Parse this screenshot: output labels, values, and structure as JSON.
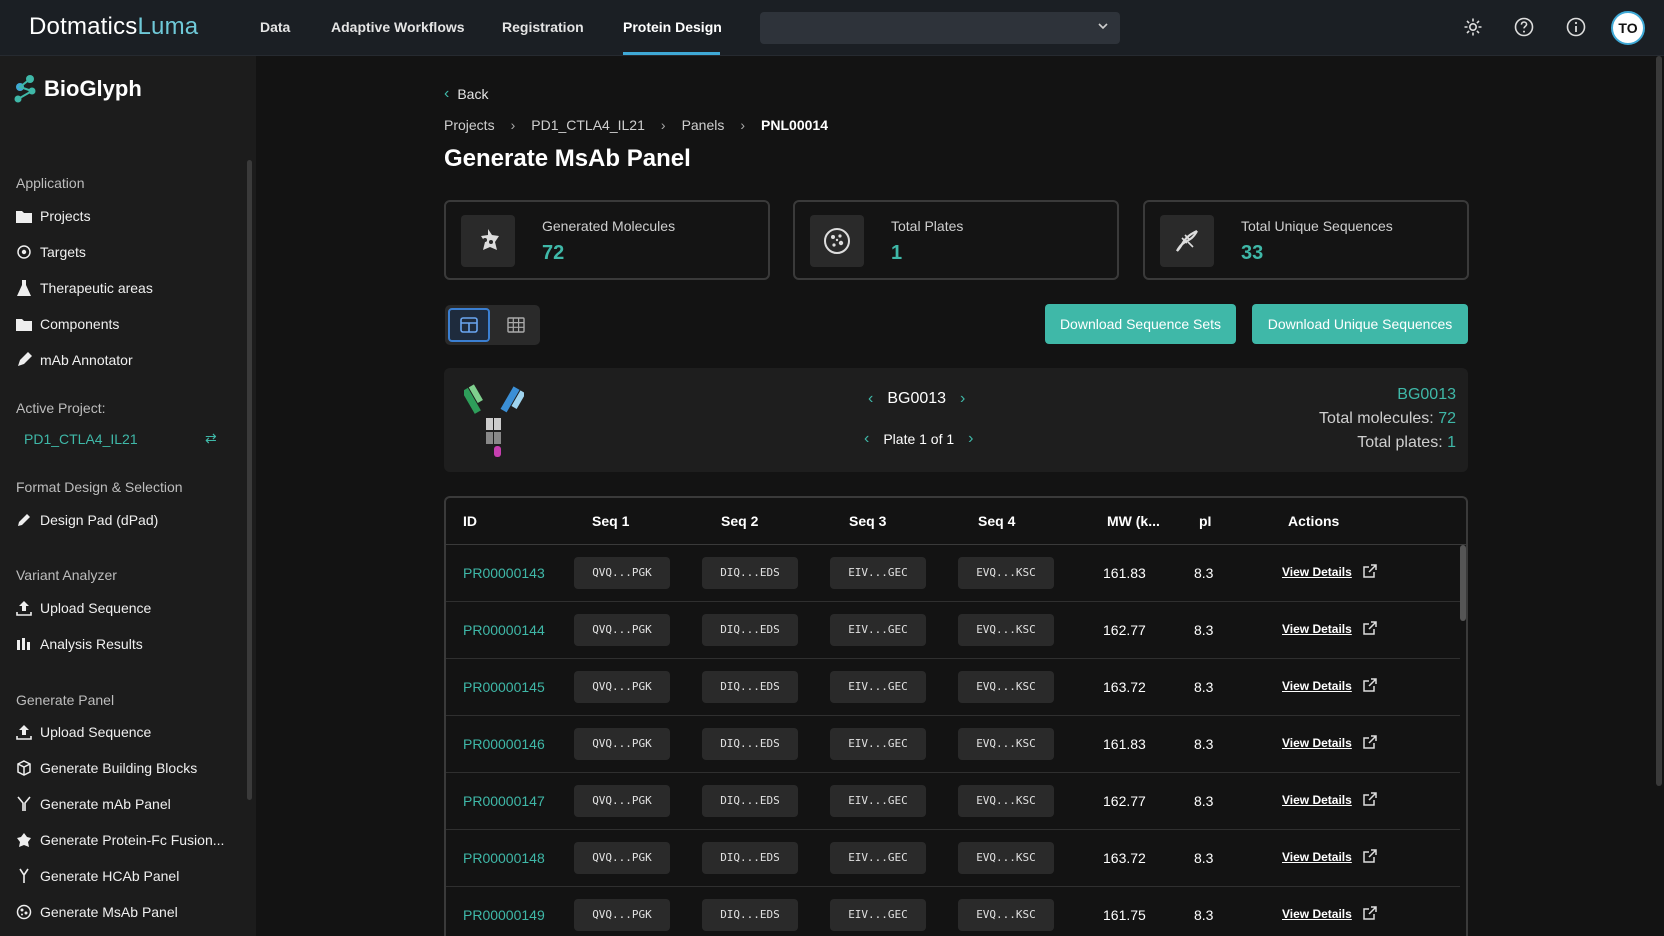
{
  "brand": {
    "name": "Dotmatics",
    "sub": "Luma"
  },
  "nav": {
    "items": [
      "Data",
      "Adaptive Workflows",
      "Registration",
      "Protein Design"
    ],
    "active": "Protein Design"
  },
  "user": {
    "initials": "TO"
  },
  "sidebar": {
    "logo_text": "BioGlyph",
    "application_title": "Application",
    "application_items": [
      "Projects",
      "Targets",
      "Therapeutic areas",
      "Components",
      "mAb Annotator"
    ],
    "active_project_title": "Active Project:",
    "active_project": "PD1_CTLA4_IL21",
    "format_title": "Format Design & Selection",
    "format_items": [
      "Design Pad (dPad)"
    ],
    "variant_title": "Variant Analyzer",
    "variant_items": [
      "Upload Sequence",
      "Analysis Results"
    ],
    "generate_title": "Generate Panel",
    "generate_items": [
      "Upload Sequence",
      "Generate Building Blocks",
      "Generate mAb Panel",
      "Generate Protein-Fc Fusion...",
      "Generate HCAb Panel",
      "Generate MsAb Panel"
    ]
  },
  "back_label": "Back",
  "breadcrumb": [
    "Projects",
    "PD1_CTLA4_IL21",
    "Panels",
    "PNL00014"
  ],
  "page_title": "Generate MsAb Panel",
  "stats": [
    {
      "label": "Generated Molecules",
      "value": "72"
    },
    {
      "label": "Total Plates",
      "value": "1"
    },
    {
      "label": "Total Unique Sequences",
      "value": "33"
    }
  ],
  "buttons": {
    "download_sets": "Download Sequence Sets",
    "download_unique": "Download Unique Sequences"
  },
  "panel": {
    "current_id": "BG0013",
    "plate_text": "Plate 1 of 1",
    "summary_id": "BG0013",
    "total_molecules_label": "Total molecules:",
    "total_molecules": "72",
    "total_plates_label": "Total plates:",
    "total_plates": "1"
  },
  "table": {
    "headers": [
      "ID",
      "Seq 1",
      "Seq 2",
      "Seq 3",
      "Seq 4",
      "MW (k...",
      "pI",
      "Actions"
    ],
    "action_label": "View Details",
    "rows": [
      {
        "id": "PR00000143",
        "s1": "QVQ...PGK",
        "s2": "DIQ...EDS",
        "s3": "EIV...GEC",
        "s4": "EVQ...KSC",
        "mw": "161.83",
        "pi": "8.3"
      },
      {
        "id": "PR00000144",
        "s1": "QVQ...PGK",
        "s2": "DIQ...EDS",
        "s3": "EIV...GEC",
        "s4": "EVQ...KSC",
        "mw": "162.77",
        "pi": "8.3"
      },
      {
        "id": "PR00000145",
        "s1": "QVQ...PGK",
        "s2": "DIQ...EDS",
        "s3": "EIV...GEC",
        "s4": "EVQ...KSC",
        "mw": "163.72",
        "pi": "8.3"
      },
      {
        "id": "PR00000146",
        "s1": "QVQ...PGK",
        "s2": "DIQ...EDS",
        "s3": "EIV...GEC",
        "s4": "EVQ...KSC",
        "mw": "161.83",
        "pi": "8.3"
      },
      {
        "id": "PR00000147",
        "s1": "QVQ...PGK",
        "s2": "DIQ...EDS",
        "s3": "EIV...GEC",
        "s4": "EVQ...KSC",
        "mw": "162.77",
        "pi": "8.3"
      },
      {
        "id": "PR00000148",
        "s1": "QVQ...PGK",
        "s2": "DIQ...EDS",
        "s3": "EIV...GEC",
        "s4": "EVQ...KSC",
        "mw": "163.72",
        "pi": "8.3"
      },
      {
        "id": "PR00000149",
        "s1": "QVQ...PGK",
        "s2": "DIQ...EDS",
        "s3": "EIV...GEC",
        "s4": "EVQ...KSC",
        "mw": "161.75",
        "pi": "8.3"
      }
    ]
  },
  "colors": {
    "accent": "#3fb8a8",
    "nav_active": "#3fa9d6",
    "background": "#131313"
  }
}
